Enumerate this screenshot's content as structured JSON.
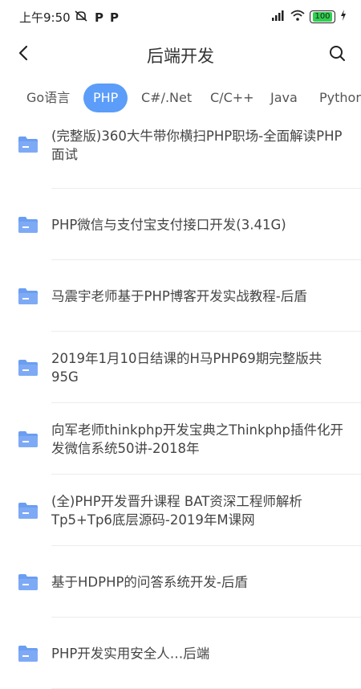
{
  "status": {
    "time": "上午9:50",
    "icons": [
      "mute-icon",
      "p-icon",
      "p-icon"
    ],
    "p1": "P",
    "p2": "P",
    "battery": "100"
  },
  "header": {
    "title": "后端开发"
  },
  "tabs": [
    {
      "label": "Go语言"
    },
    {
      "label": "PHP",
      "active": true
    },
    {
      "label": "C#/.Net"
    },
    {
      "label": "C/C++"
    },
    {
      "label": "Java"
    },
    {
      "label": "Python"
    }
  ],
  "list": [
    {
      "title": "(完整版)360大牛带你横扫PHP职场-全面解读PHP面试"
    },
    {
      "title": "PHP微信与支付宝支付接口开发(3.41G)"
    },
    {
      "title": "马震宇老师基于PHP博客开发实战教程-后盾"
    },
    {
      "title": "2019年1月10日结课的H马PHP69期完整版共95G"
    },
    {
      "title": "向军老师thinkphp开发宝典之Thinkphp插件化开发微信系统50讲-2018年"
    },
    {
      "title": "(全)PHP开发晋升课程 BAT资深工程师解析Tp5+Tp6底层源码-2019年M课网"
    },
    {
      "title": "基于HDPHP的问答系统开发-后盾"
    },
    {
      "title": "PHP开发实用安全人…后端"
    }
  ],
  "colors": {
    "accent": "#5b9df8",
    "folder": "#6b9ef2"
  }
}
